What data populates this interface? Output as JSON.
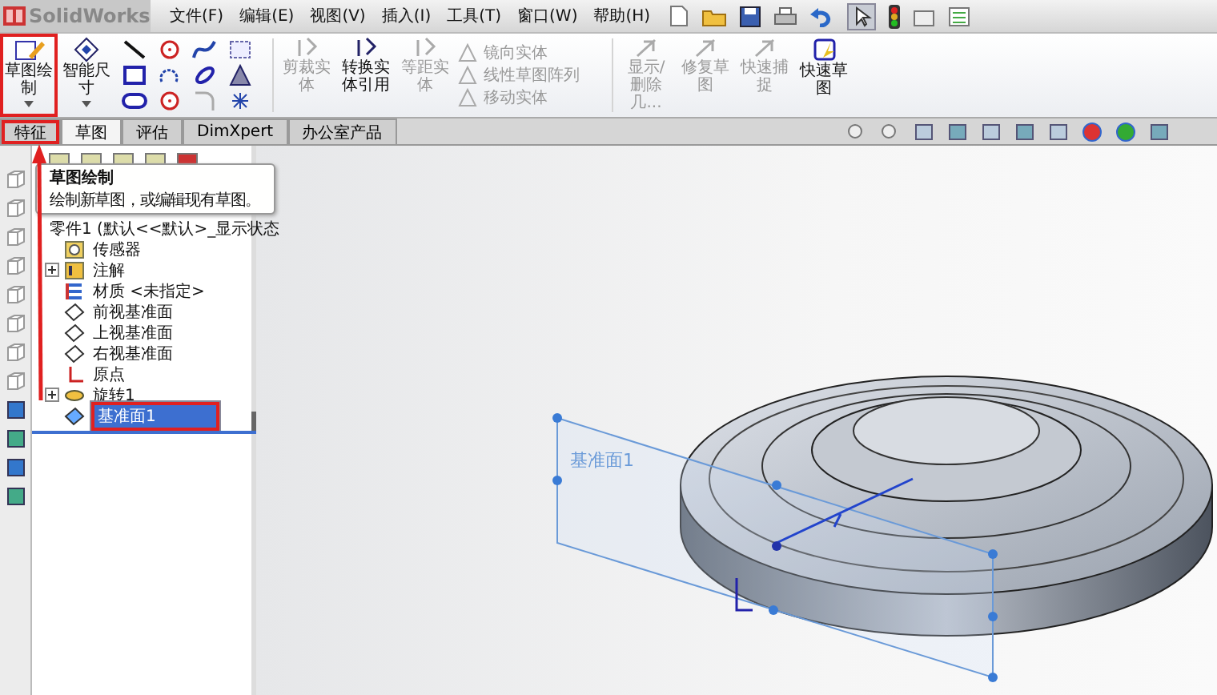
{
  "app": {
    "logo": "SolidWorks"
  },
  "menu": [
    "文件(F)",
    "编辑(E)",
    "视图(V)",
    "插入(I)",
    "工具(T)",
    "窗口(W)",
    "帮助(H)"
  ],
  "ribbon": {
    "large_tools": [
      {
        "label": "草图绘制",
        "disabled": false,
        "marked": true
      },
      {
        "label": "智能尺寸",
        "disabled": false,
        "marked": false
      }
    ],
    "mid_tools": [
      {
        "label": "剪裁实体",
        "disabled": true
      },
      {
        "label": "转换实体引用",
        "disabled": false
      },
      {
        "label": "等距实体",
        "disabled": true
      }
    ],
    "list_tools": [
      {
        "label": "镜向实体",
        "disabled": true
      },
      {
        "label": "线性草图阵列",
        "disabled": true
      },
      {
        "label": "移动实体",
        "disabled": true
      }
    ],
    "right_tools": [
      {
        "label": "显示/删除几...",
        "disabled": true
      },
      {
        "label": "修复草图",
        "disabled": true
      },
      {
        "label": "快速捕捉",
        "disabled": true
      },
      {
        "label": "快速草图",
        "disabled": false
      }
    ]
  },
  "tabs": [
    {
      "label": "特征",
      "selected": false,
      "marked": true
    },
    {
      "label": "草图",
      "selected": true,
      "marked": false
    },
    {
      "label": "评估",
      "selected": false,
      "marked": false
    },
    {
      "label": "DimXpert",
      "selected": false,
      "marked": false
    },
    {
      "label": "办公室产品",
      "selected": false,
      "marked": false
    }
  ],
  "tooltip": {
    "title": "草图绘制",
    "text": "绘制新草图，或编辑现有草图。"
  },
  "tree": {
    "root": "零件1 (默认<<默认>_显示状态",
    "items": [
      {
        "label": "传感器",
        "kind": "sensor",
        "has_children": false,
        "selected": false,
        "marked": false
      },
      {
        "label": "注解",
        "kind": "annotation",
        "has_children": true,
        "selected": false,
        "marked": false
      },
      {
        "label": "材质 <未指定>",
        "kind": "material",
        "has_children": false,
        "selected": false,
        "marked": false
      },
      {
        "label": "前视基准面",
        "kind": "plane",
        "has_children": false,
        "selected": false,
        "marked": false
      },
      {
        "label": "上视基准面",
        "kind": "plane",
        "has_children": false,
        "selected": false,
        "marked": false
      },
      {
        "label": "右视基准面",
        "kind": "plane",
        "has_children": false,
        "selected": false,
        "marked": false
      },
      {
        "label": "原点",
        "kind": "origin",
        "has_children": false,
        "selected": false,
        "marked": false
      },
      {
        "label": "旋转1",
        "kind": "feature",
        "has_children": true,
        "selected": false,
        "marked": false
      },
      {
        "label": "基准面1",
        "kind": "plane",
        "has_children": false,
        "selected": true,
        "marked": true
      }
    ]
  },
  "viewport": {
    "plane_label": "基准面1"
  }
}
